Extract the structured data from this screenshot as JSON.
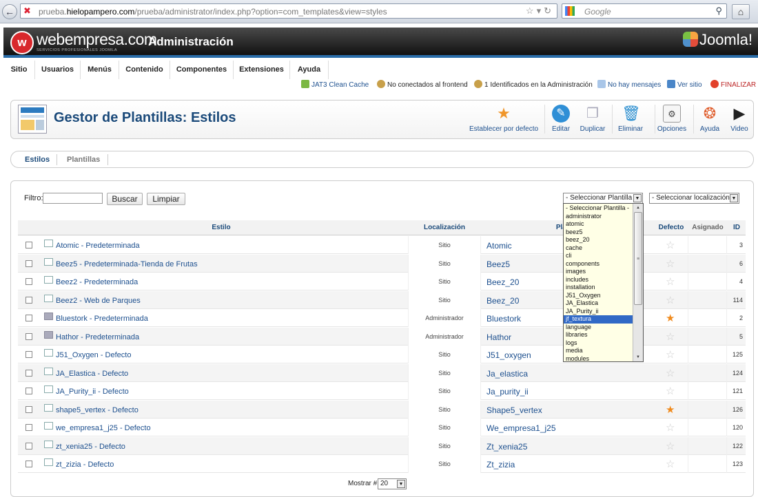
{
  "browser": {
    "url_prefix": "prueba.",
    "url_domain": "hielopampero.com",
    "url_path": "/prueba/administrator/index.php?option=com_templates&view=styles",
    "search_placeholder": "Google"
  },
  "header": {
    "brand_name": "webempresa.com",
    "brand_tagline": "SERVICIOS PROFESIONALES JOOMLA",
    "title": "Administración",
    "joomla_label": "Joomla!"
  },
  "menu": [
    "Sitio",
    "Usuarios",
    "Menús",
    "Contenido",
    "Componentes",
    "Extensiones",
    "Ayuda"
  ],
  "status_bar": {
    "cache": "JAT3 Clean Cache",
    "frontend": "No conectados al frontend",
    "admin": "1 Identificados en la Administración",
    "messages": "No hay mensajes",
    "view_site": "Ver sitio",
    "logout": "FINALIZAR"
  },
  "toolbar": {
    "page_title": "Gestor de Plantillas: Estilos",
    "buttons": [
      "Establecer por defecto",
      "Editar",
      "Duplicar",
      "Eliminar",
      "Opciones",
      "Ayuda",
      "Video"
    ]
  },
  "subnav": [
    "Estilos",
    "Plantillas"
  ],
  "filters": {
    "filter_label": "Filtro:",
    "search_button": "Buscar",
    "clear_button": "Limpiar",
    "template_select": "- Seleccionar Plantilla -",
    "location_select": "- Seleccionar localización -"
  },
  "dropdown_options": [
    "- Seleccionar Plantilla -",
    "administrator",
    "atomic",
    "beez5",
    "beez_20",
    "cache",
    "cli",
    "components",
    "images",
    "includes",
    "installation",
    "J51_Oxygen",
    "JA_Elastica",
    "JA_Purity_ii",
    "jf_textura",
    "language",
    "libraries",
    "logs",
    "media",
    "modules"
  ],
  "dropdown_selected_index": 14,
  "table": {
    "headers": {
      "style": "Estilo",
      "location": "Localización",
      "template": "Plantilla",
      "default": "Defecto",
      "assigned": "Asignado",
      "id": "ID"
    },
    "rows": [
      {
        "style": "Atomic - Predeterminada",
        "location": "Sitio",
        "template": "Atomic",
        "default": false,
        "id": "3"
      },
      {
        "style": "Beez5 - Predeterminada-Tienda de Frutas",
        "location": "Sitio",
        "template": "Beez5",
        "default": false,
        "id": "6"
      },
      {
        "style": "Beez2 - Predeterminada",
        "location": "Sitio",
        "template": "Beez_20",
        "default": false,
        "id": "4"
      },
      {
        "style": "Beez2 - Web de Parques",
        "location": "Sitio",
        "template": "Beez_20",
        "default": false,
        "id": "114"
      },
      {
        "style": "Bluestork - Predeterminada",
        "location": "Administrador",
        "template": "Bluestork",
        "default": true,
        "id": "2"
      },
      {
        "style": "Hathor - Predeterminada",
        "location": "Administrador",
        "template": "Hathor",
        "default": false,
        "id": "5"
      },
      {
        "style": "J51_Oxygen - Defecto",
        "location": "Sitio",
        "template": "J51_oxygen",
        "default": false,
        "id": "125"
      },
      {
        "style": "JA_Elastica - Defecto",
        "location": "Sitio",
        "template": "Ja_elastica",
        "default": false,
        "id": "124"
      },
      {
        "style": "JA_Purity_ii - Defecto",
        "location": "Sitio",
        "template": "Ja_purity_ii",
        "default": false,
        "id": "121"
      },
      {
        "style": "shape5_vertex - Defecto",
        "location": "Sitio",
        "template": "Shape5_vertex",
        "default": true,
        "id": "126"
      },
      {
        "style": "we_empresa1_j25 - Defecto",
        "location": "Sitio",
        "template": "We_empresa1_j25",
        "default": false,
        "id": "120"
      },
      {
        "style": "zt_xenia25 - Defecto",
        "location": "Sitio",
        "template": "Zt_xenia25",
        "default": false,
        "id": "122"
      },
      {
        "style": "zt_zizia - Defecto",
        "location": "Sitio",
        "template": "Zt_zizia",
        "default": false,
        "id": "123"
      }
    ]
  },
  "pager": {
    "label": "Mostrar #",
    "value": "20"
  },
  "colors": {
    "accent": "#1c4f8e",
    "header_bg": "#1a1a1a",
    "header_stripe": "#2a6ca8",
    "star_on": "#f08a1c",
    "dropdown_selected": "#3169c6"
  }
}
